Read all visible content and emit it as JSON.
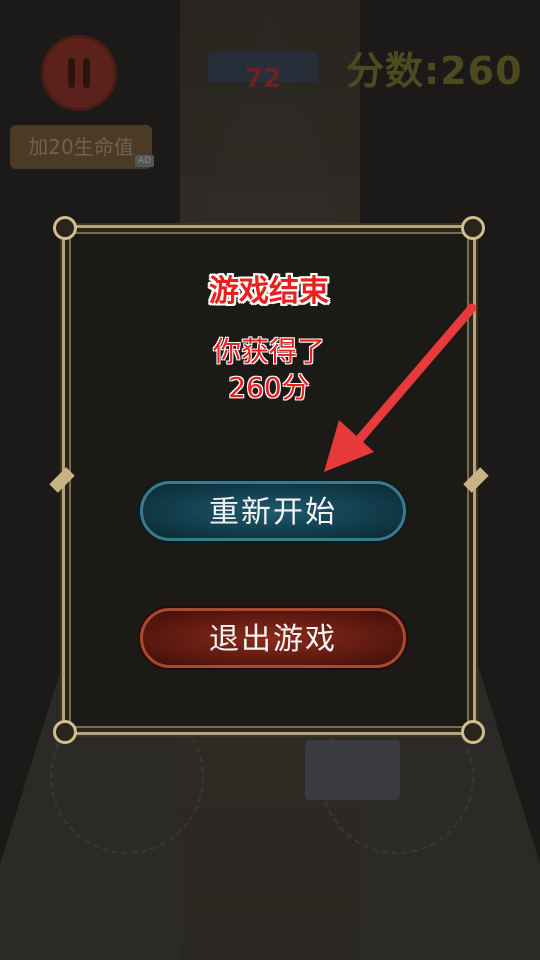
{
  "hud": {
    "score_text": "分数:260",
    "counter_value": "72",
    "add_hp_label": "加20生命值",
    "ad_badge": "AD"
  },
  "modal": {
    "title": "游戏结束",
    "result_line1": "你获得了",
    "result_line2": "260分",
    "restart_label": "重新开始",
    "exit_label": "退出游戏"
  },
  "colors": {
    "title_red": "#e8201e",
    "restart_teal": "#123b4a",
    "exit_red": "#5e1a10",
    "frame_gold": "#b8a27c",
    "arrow_red": "#e83a3a"
  }
}
